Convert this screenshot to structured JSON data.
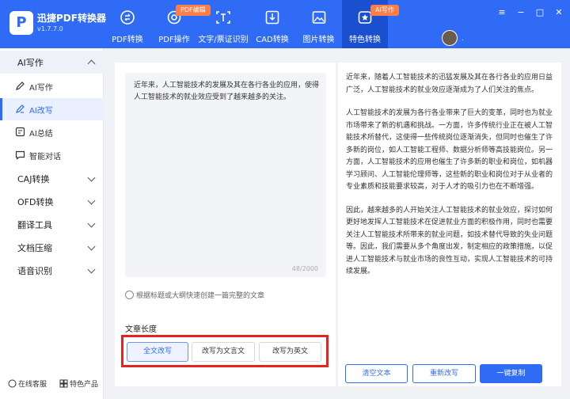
{
  "app": {
    "name": "迅捷PDF转换器",
    "version": "v1.7.7.0",
    "logo_letter": "P"
  },
  "nav": [
    {
      "label": "PDF转换",
      "icon": "pdf-convert-icon"
    },
    {
      "label": "PDF操作",
      "icon": "pdf-operate-icon",
      "badge": "PDF编辑"
    },
    {
      "label": "文字/票证识别",
      "icon": "text-recognition-icon"
    },
    {
      "label": "CAD转换",
      "icon": "cad-convert-icon"
    },
    {
      "label": "图片转换",
      "icon": "image-convert-icon"
    },
    {
      "label": "特色转换",
      "icon": "special-convert-icon",
      "badge": "AI写作",
      "active": true
    }
  ],
  "window_controls": {
    "menu": "≡",
    "minimize": "−",
    "maximize": "□",
    "close": "✕",
    "avatar_dot": "."
  },
  "sidebar": {
    "ai_group": "AI写作",
    "ai_items": [
      {
        "label": "AI写作",
        "icon": "pen-icon"
      },
      {
        "label": "AI改写",
        "icon": "rewrite-icon",
        "active": true
      },
      {
        "label": "AI总结",
        "icon": "summary-icon"
      },
      {
        "label": "智能对话",
        "icon": "chat-icon"
      }
    ],
    "groups": [
      "CAJ转换",
      "OFD转换",
      "翻译工具",
      "文档压缩",
      "语音识别"
    ],
    "footer": {
      "service": "在线客服",
      "products": "特色产品"
    }
  },
  "editor": {
    "text": "近年来，人工智能技术的发展及其在各行各业的应用，使得人工智能技术的就业效应受到了越来越多的关注。",
    "count": "48/2000",
    "hint": "根据标题或大纲快速创建一篇完整的文章"
  },
  "length": {
    "label": "文章长度",
    "options": [
      "全文改写",
      "改写为文言文",
      "改写为英文"
    ],
    "selected": "全文改写"
  },
  "output": {
    "paragraphs": [
      "近年来，随着人工智能技术的迅猛发展及其在各行各业的应用日益广泛，人工智能技术的就业效应逐渐成为了人们关注的焦点。",
      "人工智能技术的发展为各行各业带来了巨大的变革，同时也为就业市场带来了新的机遇和挑战。一方面，许多传统行业正在被人工智能技术所替代，这使得一些传统岗位逐渐消失，但同时也催生了许多新的岗位，如人工智能工程师、数据分析师等高技能岗位。另一方面，人工智能技术的应用也催生了许多新的职业和岗位，如机器学习顾问、人工智能伦理师等，这些新的职业和岗位对于从业者的专业素质和技能要求较高，对于人才的吸引力也在不断增强。",
      "因此，越来越多的人开始关注人工智能技术的就业效应，探讨如何更好地发挥人工智能技术在促进就业方面的积极作用，同时也需要关注人工智能技术所带来的就业问题，如技术替代导致的失业问题等。因此，我们需要从多个角度出发，制定相应的政策措施，以促进人工智能技术与就业市场的良性互动，实现人工智能技术的可持续发展。"
    ]
  },
  "actions": {
    "clear": "清空文本",
    "rewrite": "重新改写",
    "copy": "一键复制"
  },
  "colors": {
    "accent": "#2f6bf5",
    "badge": "#ff7d49",
    "highlight_box": "#e42420"
  }
}
